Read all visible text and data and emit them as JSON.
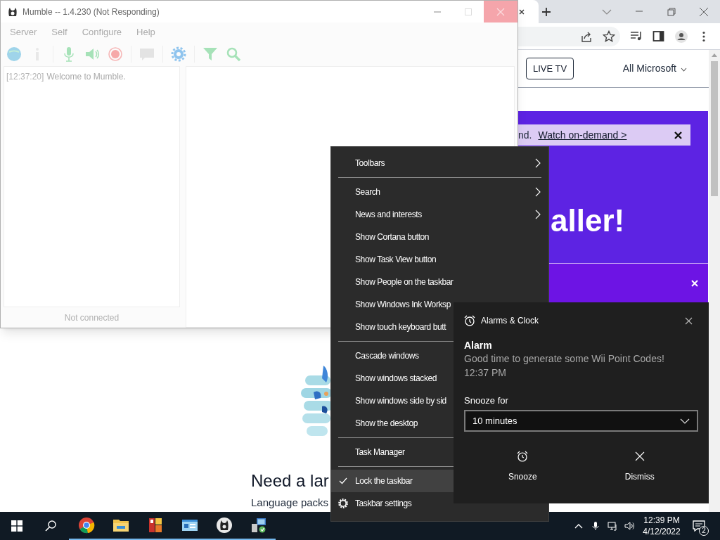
{
  "browser": {
    "header": {
      "live_tv": "LIVE TV",
      "menu": "All Microsoft"
    },
    "notice": {
      "text": "nd.",
      "link": "Watch on-demand >"
    },
    "headline": "aller!",
    "below": {
      "heading": "Need a lar",
      "text": "Language packs"
    }
  },
  "mumble": {
    "title": "Mumble -- 1.4.230 (Not Responding)",
    "menus": [
      "Server",
      "Self",
      "Configure",
      "Help"
    ],
    "log": [
      {
        "time": "[12:37:20]",
        "text": "Welcome to Mumble."
      }
    ],
    "status": "Not connected"
  },
  "context_menu": {
    "groups": [
      [
        {
          "label": "Toolbars",
          "kind": "submenu",
          "checked": false,
          "selected": false
        }
      ],
      [
        {
          "label": "Search",
          "kind": "submenu",
          "checked": false,
          "selected": false
        },
        {
          "label": "News and interests",
          "kind": "submenu",
          "checked": false,
          "selected": false
        },
        {
          "label": "Show Cortana button",
          "kind": "plain",
          "checked": false,
          "selected": false
        },
        {
          "label": "Show Task View button",
          "kind": "plain",
          "checked": false,
          "selected": false
        },
        {
          "label": "Show People on the taskbar",
          "kind": "plain",
          "checked": false,
          "selected": false
        },
        {
          "label": "Show Windows Ink Worksp",
          "kind": "plain",
          "checked": false,
          "selected": false
        },
        {
          "label": "Show touch keyboard butt",
          "kind": "plain",
          "checked": false,
          "selected": false
        }
      ],
      [
        {
          "label": "Cascade windows",
          "kind": "plain",
          "checked": false,
          "selected": false
        },
        {
          "label": "Show windows stacked",
          "kind": "plain",
          "checked": false,
          "selected": false
        },
        {
          "label": "Show windows side by sid",
          "kind": "plain",
          "checked": false,
          "selected": false
        },
        {
          "label": "Show the desktop",
          "kind": "plain",
          "checked": false,
          "selected": false
        }
      ],
      [
        {
          "label": "Task Manager",
          "kind": "plain",
          "checked": false,
          "selected": false
        }
      ],
      [
        {
          "label": "Lock the taskbar",
          "kind": "plain",
          "checked": true,
          "selected": true
        },
        {
          "label": "Taskbar settings",
          "kind": "settings",
          "checked": false,
          "selected": false
        }
      ]
    ]
  },
  "notification": {
    "app": "Alarms & Clock",
    "title": "Alarm",
    "message": "Good time to generate some Wii Point Codes!",
    "time": "12:37 PM",
    "snooze_label": "Snooze for",
    "snooze_value": "10 minutes",
    "actions": [
      {
        "label": "Snooze",
        "kind": "snooze"
      },
      {
        "label": "Dismiss",
        "kind": "dismiss"
      }
    ]
  },
  "taskbar": {
    "apps": [
      {
        "kind": "chrome",
        "running": true
      },
      {
        "kind": "folder",
        "running": true
      },
      {
        "kind": "tiles",
        "running": true
      },
      {
        "kind": "window",
        "running": true
      },
      {
        "kind": "headset",
        "running": true
      },
      {
        "kind": "computer",
        "running": true
      }
    ],
    "time": "12:39 PM",
    "date": "4/12/2022",
    "badge": "2"
  }
}
